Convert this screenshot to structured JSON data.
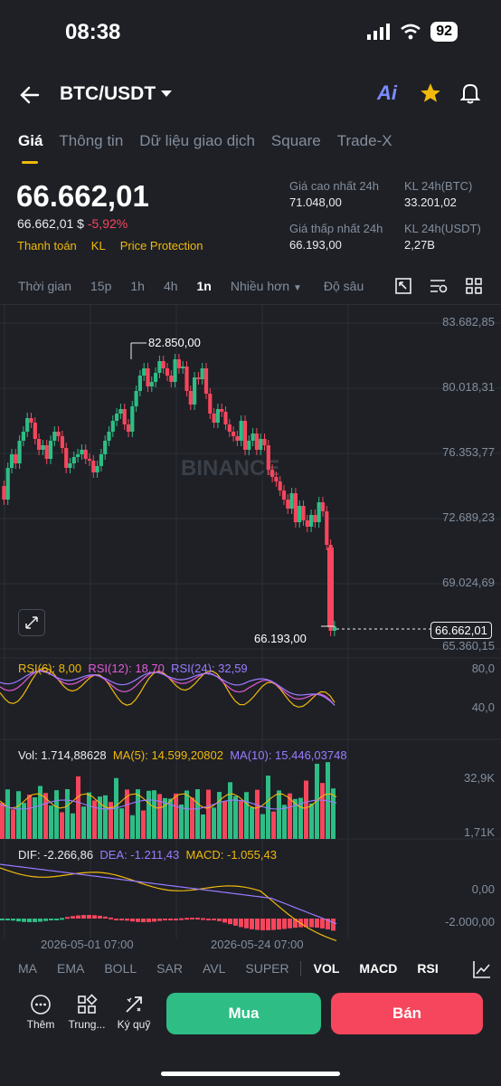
{
  "status": {
    "time": "08:38",
    "battery": "92"
  },
  "header": {
    "pair": "BTC/USDT",
    "ai_label": "Ai"
  },
  "tabs": [
    "Giá",
    "Thông tin",
    "Dữ liệu giao dịch",
    "Square",
    "Trade-X"
  ],
  "price": {
    "last": "66.662,01",
    "usd": "66.662,01 $",
    "change": "-5,92%",
    "links": [
      "Thanh toán",
      "KL",
      "Price Protection"
    ]
  },
  "stats": {
    "high_label": "Giá cao nhất 24h",
    "high": "71.048,00",
    "low_label": "Giá thấp nhất 24h",
    "low": "66.193,00",
    "vol_btc_label": "KL 24h(BTC)",
    "vol_btc": "33.201,02",
    "vol_usdt_label": "KL 24h(USDT)",
    "vol_usdt": "2,27B"
  },
  "intervals": [
    "Thời gian",
    "15p",
    "1h",
    "4h",
    "1n",
    "Nhiều hơn",
    "Độ sâu"
  ],
  "chart": {
    "price_axis": [
      "83.682,85",
      "80.018,31",
      "76.353,77",
      "72.689,23",
      "69.024,69",
      "65.360,15"
    ],
    "high_marker": "82.850,00",
    "low_marker": "66.193,00",
    "current_tag": "66.662,01",
    "watermark": "BINANCE",
    "rsi": {
      "r6": "RSI(6): 8,00",
      "r12": "RSI(12): 18,70",
      "r24": "RSI(24): 32,59",
      "axis_top": "80,0",
      "axis_mid": "40,0"
    },
    "vol": {
      "vol": "Vol: 1.714,88628",
      "ma5": "MA(5): 14.599,20802",
      "ma10": "MA(10): 15.446,03748",
      "axis_top": "32,9K",
      "axis_bot": "1,71K"
    },
    "macd": {
      "dif": "DIF: -2.266,86",
      "dea": "DEA: -1.211,43",
      "macd": "MACD: -1.055,43",
      "axis_top": "0,00",
      "axis_bot": "-2.000,00"
    },
    "dates": [
      "2026-05-01 07:00",
      "2026-05-24 07:00"
    ],
    "colors": {
      "up": "#2ebd85",
      "down": "#f6465d",
      "rsi6": "#f0b90b",
      "rsi12": "#e25bd6",
      "rsi24": "#9b7bff"
    }
  },
  "indicators": [
    "MA",
    "EMA",
    "BOLL",
    "SAR",
    "AVL",
    "SUPER",
    "VOL",
    "MACD",
    "RSI"
  ],
  "actions": {
    "more": "Thêm",
    "center": "Trung...",
    "margin": "Ký quỹ",
    "buy": "Mua",
    "sell": "Bán"
  }
}
